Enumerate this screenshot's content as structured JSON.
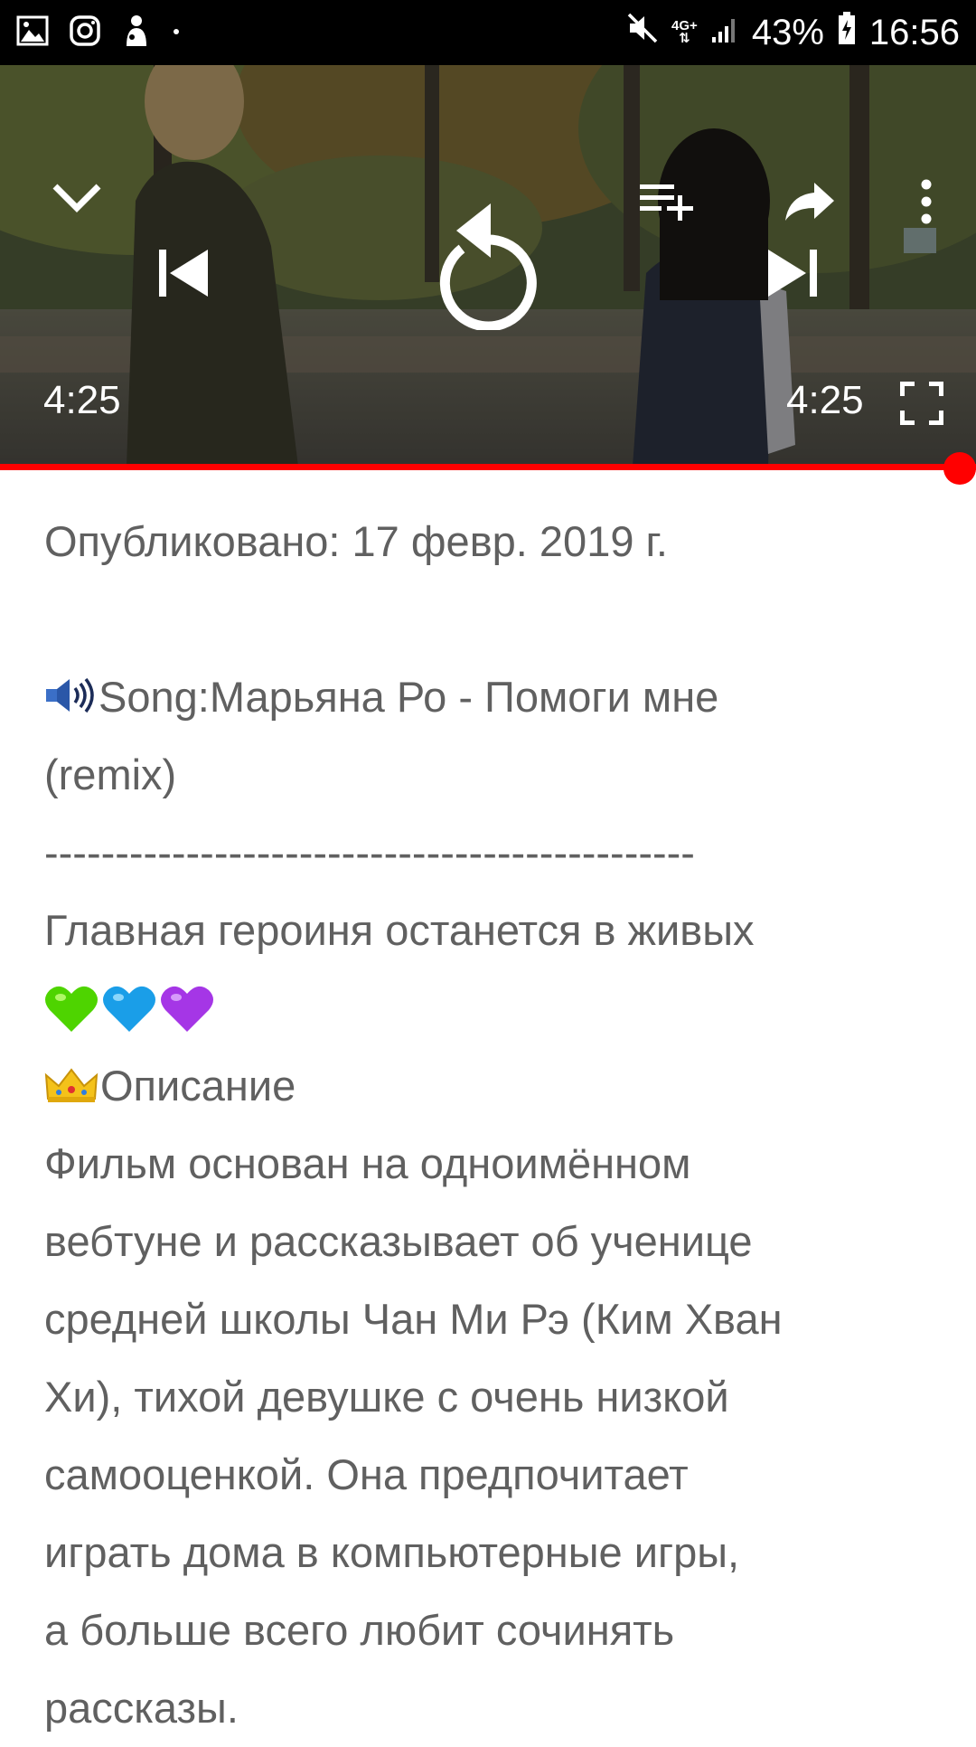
{
  "status_bar": {
    "network_label": "4G+",
    "battery": "43%",
    "time": "16:56"
  },
  "player": {
    "elapsed_time": "4:25",
    "total_time": "4:25",
    "progress": 1.0,
    "progress_color": "#ff0000"
  },
  "description": {
    "published": "Опубликовано: 17 февр. 2019 г.",
    "song_line_1": "Song:Марьяна Ро -  Помоги мне",
    "song_line_2": "(remix)",
    "separator": "----------------------------------------------",
    "heroine_line": "Главная героиня останется в живых",
    "hearts": [
      "green-heart",
      "blue-heart",
      "purple-heart"
    ],
    "section_title": "Описание",
    "body_lines": [
      "Фильм основан на одноимённом",
      "вебтуне и рассказывает об ученице",
      "средней школы Чан Ми Рэ (Ким Хван",
      "Хи), тихой девушке с очень низкой",
      "самооценкой. Она предпочитает",
      "играть дома в компьютерные игры,",
      "а больше всего любит сочинять",
      "рассказы."
    ]
  }
}
